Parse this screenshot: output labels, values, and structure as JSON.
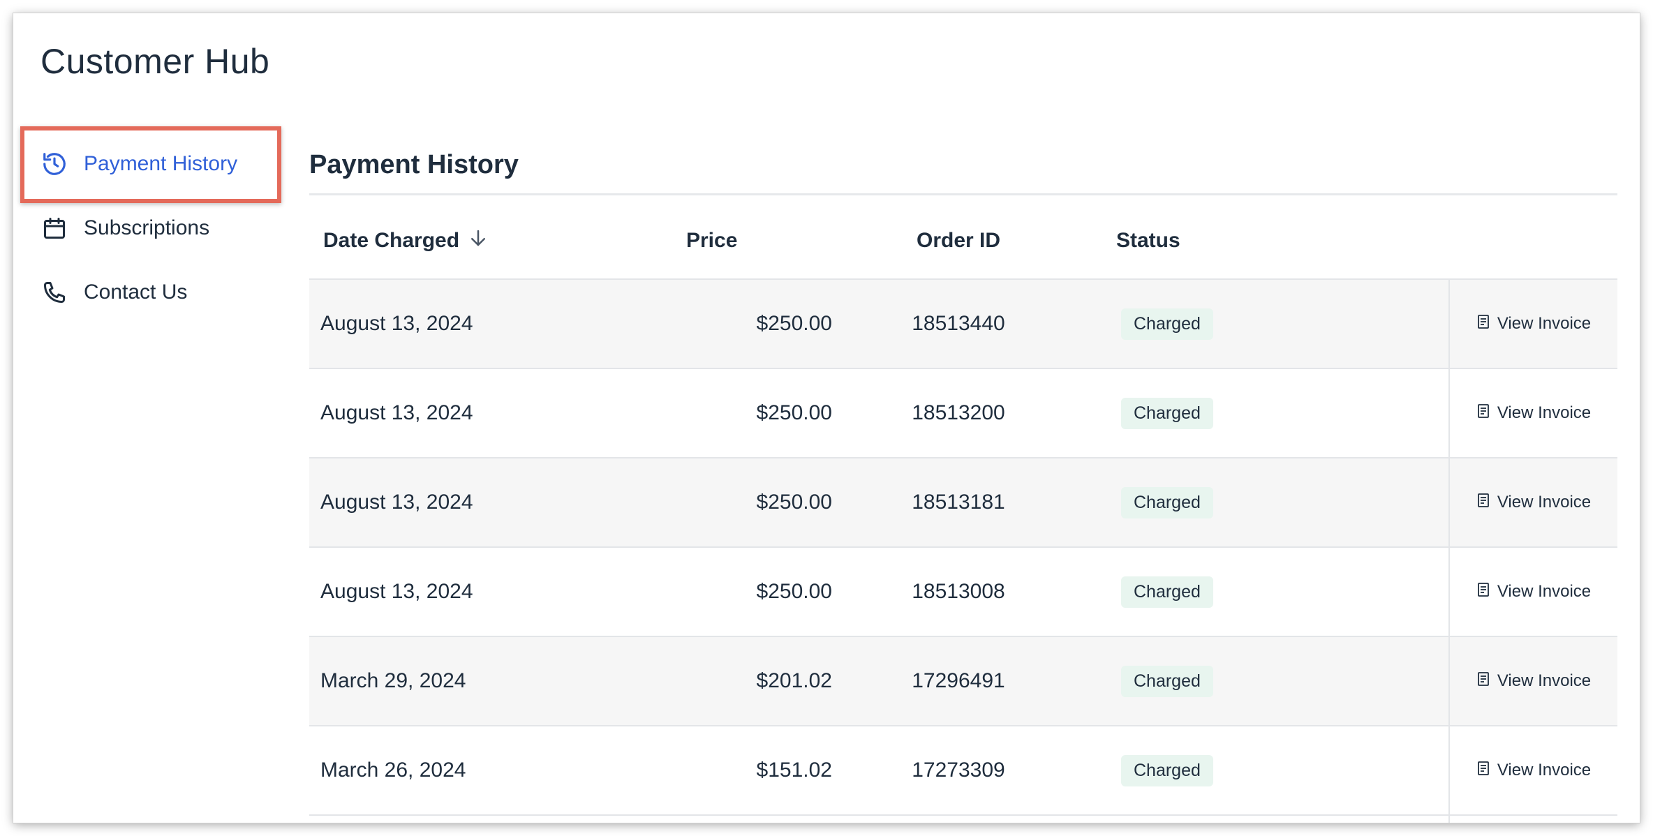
{
  "app": {
    "title": "Customer Hub"
  },
  "sidebar": {
    "items": [
      {
        "label": "Payment History",
        "icon": "history-icon",
        "active": true
      },
      {
        "label": "Subscriptions",
        "icon": "calendar-icon",
        "active": false
      },
      {
        "label": "Contact Us",
        "icon": "phone-icon",
        "active": false
      }
    ]
  },
  "main": {
    "section_title": "Payment History",
    "table": {
      "columns": {
        "date": "Date Charged",
        "price": "Price",
        "order": "Order ID",
        "status": "Status"
      },
      "sort": {
        "column": "date",
        "direction": "descending",
        "icon": "arrow-down-icon"
      },
      "rows": [
        {
          "date": "August 13, 2024",
          "price": "$250.00",
          "order": "18513440",
          "status": "Charged",
          "action": "View Invoice"
        },
        {
          "date": "August 13, 2024",
          "price": "$250.00",
          "order": "18513200",
          "status": "Charged",
          "action": "View Invoice"
        },
        {
          "date": "August 13, 2024",
          "price": "$250.00",
          "order": "18513181",
          "status": "Charged",
          "action": "View Invoice"
        },
        {
          "date": "August 13, 2024",
          "price": "$250.00",
          "order": "18513008",
          "status": "Charged",
          "action": "View Invoice"
        },
        {
          "date": "March 29, 2024",
          "price": "$201.02",
          "order": "17296491",
          "status": "Charged",
          "action": "View Invoice"
        },
        {
          "date": "March 26, 2024",
          "price": "$151.02",
          "order": "17273309",
          "status": "Charged",
          "action": "View Invoice"
        }
      ]
    }
  },
  "colors": {
    "accent": "#3060d8",
    "text": "#1f2d3d",
    "highlight": "#e46a5a",
    "badge_bg": "#e8f5ef",
    "row_alt": "#f6f6f6"
  }
}
